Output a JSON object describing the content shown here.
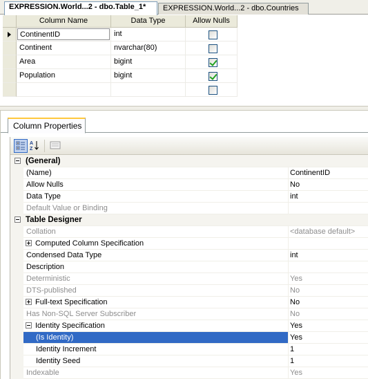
{
  "doc_tabs": [
    {
      "label": "EXPRESSION.World...2 - dbo.Table_1*",
      "active": true
    },
    {
      "label": "EXPRESSION.World...2 - dbo.Countries",
      "active": false
    }
  ],
  "grid": {
    "headers": {
      "name": "Column Name",
      "type": "Data Type",
      "nulls": "Allow Nulls"
    },
    "rows": [
      {
        "name": "ContinentID",
        "type": "int",
        "allow_nulls": false
      },
      {
        "name": "Continent",
        "type": "nvarchar(80)",
        "allow_nulls": false
      },
      {
        "name": "Area",
        "type": "bigint",
        "allow_nulls": true
      },
      {
        "name": "Population",
        "type": "bigint",
        "allow_nulls": true
      },
      {
        "name": "",
        "type": "",
        "allow_nulls": false
      }
    ]
  },
  "properties": {
    "tab_label": "Column Properties",
    "toolbar": [
      "categorized-icon",
      "alphabetical-icon",
      "property-pages-icon"
    ],
    "rows": [
      {
        "kind": "cat",
        "name": "(General)"
      },
      {
        "kind": "prop",
        "name": "(Name)",
        "value": "ContinentID"
      },
      {
        "kind": "prop",
        "name": "Allow Nulls",
        "value": "No"
      },
      {
        "kind": "prop",
        "name": "Data Type",
        "value": "int"
      },
      {
        "kind": "dim",
        "name": "Default Value or Binding",
        "value": ""
      },
      {
        "kind": "cat",
        "name": "Table Designer"
      },
      {
        "kind": "dim",
        "name": "Collation",
        "value": "<database default>"
      },
      {
        "kind": "plus",
        "name": "Computed Column Specification",
        "value": ""
      },
      {
        "kind": "prop",
        "name": "Condensed Data Type",
        "value": "int"
      },
      {
        "kind": "prop",
        "name": "Description",
        "value": ""
      },
      {
        "kind": "dim",
        "name": "Deterministic",
        "value": "Yes"
      },
      {
        "kind": "dim",
        "name": "DTS-published",
        "value": "No"
      },
      {
        "kind": "plus",
        "name": "Full-text Specification",
        "value": "No"
      },
      {
        "kind": "dim",
        "name": "Has Non-SQL Server Subscriber",
        "value": "No"
      },
      {
        "kind": "minus",
        "name": "Identity Specification",
        "value": "Yes"
      },
      {
        "kind": "sel",
        "name": "(Is Identity)",
        "value": "Yes"
      },
      {
        "kind": "sub",
        "name": "Identity Increment",
        "value": "1"
      },
      {
        "kind": "sub",
        "name": "Identity Seed",
        "value": "1"
      },
      {
        "kind": "dim",
        "name": "Indexable",
        "value": "Yes"
      }
    ]
  }
}
